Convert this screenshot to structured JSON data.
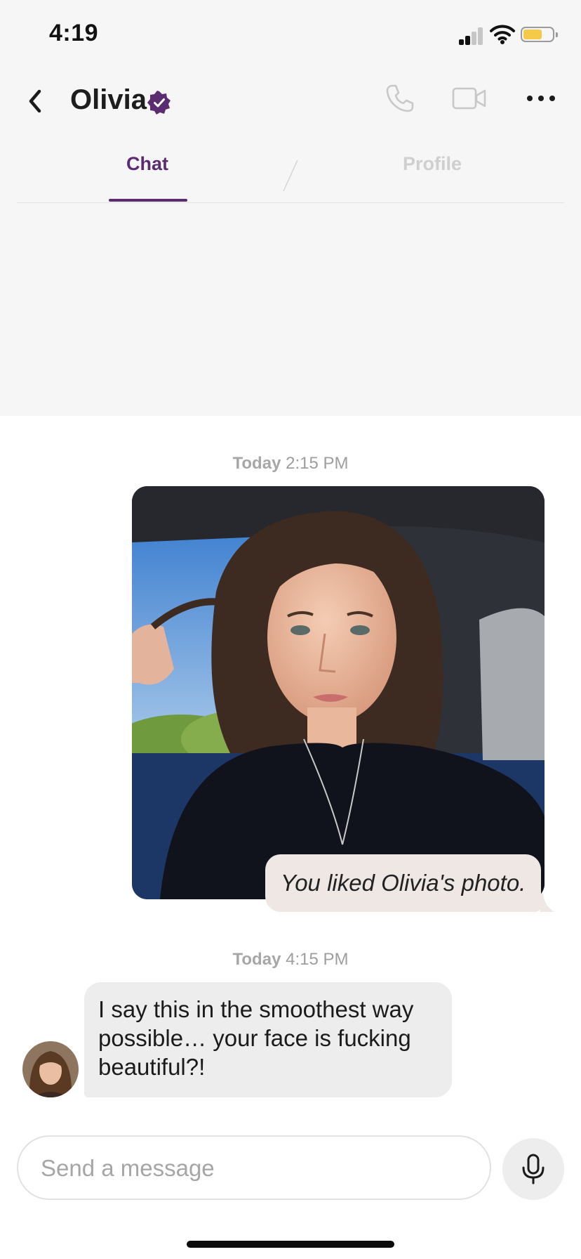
{
  "status_bar": {
    "time": "4:19",
    "battery_color": "#f5c94a"
  },
  "header": {
    "contact_name": "Olivia",
    "icons": [
      "back-icon",
      "verified-badge-icon",
      "phone-icon",
      "video-camera-icon",
      "more-icon"
    ]
  },
  "tabs": [
    {
      "label": "Chat",
      "active": true
    },
    {
      "label": "Profile",
      "active": false
    }
  ],
  "colors": {
    "accent": "#5b2c6f",
    "liked_bubble": "#efe7e4",
    "message_bubble": "#ededee"
  },
  "conversation": {
    "first_timestamp": {
      "day": "Today",
      "time": "2:15 PM"
    },
    "liked_photo_text": "You liked Olivia's photo.",
    "second_timestamp": {
      "day": "Today",
      "time": "4:15 PM"
    },
    "incoming_message": "I say this in the smoothest way possible… your face is fucking beautiful?!"
  },
  "composer": {
    "placeholder": "Send a message",
    "value": "",
    "mic_icon": "microphone-icon"
  }
}
